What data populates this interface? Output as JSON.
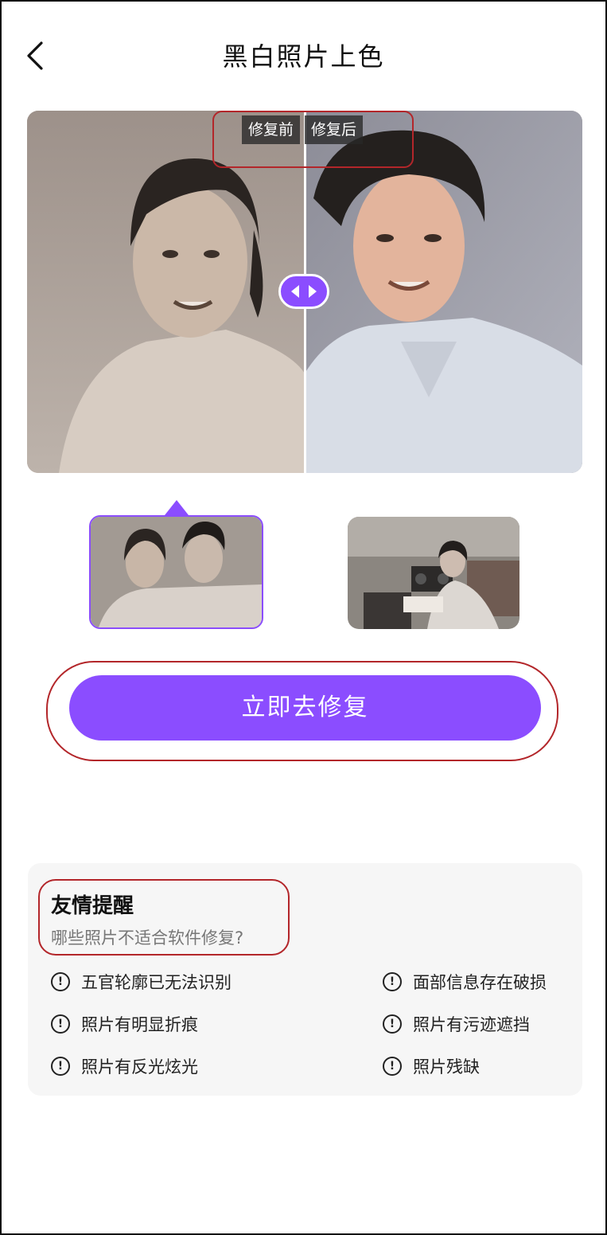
{
  "header": {
    "back_icon": "chevron-left-icon",
    "title": "黑白照片上色"
  },
  "compare": {
    "before_label": "修复前",
    "after_label": "修复后",
    "handle_icon": "left-right-arrows-icon"
  },
  "samples": {
    "items": [
      {
        "name": "sample-couple",
        "selected": true
      },
      {
        "name": "sample-woman-radio",
        "selected": false
      }
    ]
  },
  "cta": {
    "label": "立即去修复"
  },
  "tips": {
    "title": "友情提醒",
    "subtitle": "哪些照片不适合软件修复?",
    "icon": "exclamation-circle-icon",
    "items": [
      "五官轮廓已无法识别",
      "面部信息存在破损",
      "照片有明显折痕",
      "照片有污迹遮挡",
      "照片有反光炫光",
      "照片残缺"
    ]
  },
  "colors": {
    "accent": "#8b4dff",
    "annotation": "#b3262a"
  }
}
